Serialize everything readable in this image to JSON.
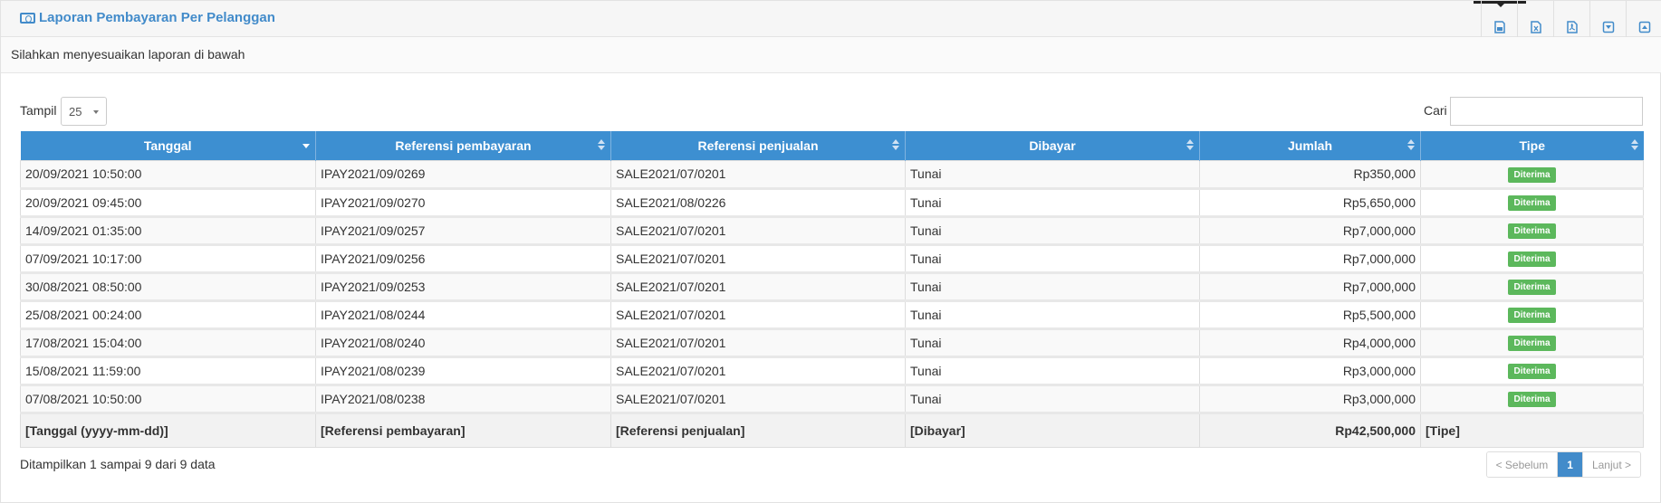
{
  "header": {
    "title": "Laporan Pembayaran Per Pelanggan",
    "toolbar": [
      {
        "icon": "save-image-icon"
      },
      {
        "icon": "excel-icon"
      },
      {
        "icon": "pdf-icon"
      },
      {
        "icon": "collapse-down-icon"
      },
      {
        "icon": "collapse-up-icon"
      }
    ]
  },
  "subheader": {
    "text": "Silahkan menyesuaikan laporan di bawah"
  },
  "controls": {
    "show_label": "Tampil",
    "page_length": "25",
    "search_label": "Cari",
    "search_value": ""
  },
  "table": {
    "columns": [
      "Tanggal",
      "Referensi pembayaran",
      "Referensi penjualan",
      "Dibayar",
      "Jumlah",
      "Tipe"
    ],
    "rows": [
      {
        "tanggal": "20/09/2021 10:50:00",
        "ref_bayar": "IPAY2021/09/0269",
        "ref_jual": "SALE2021/07/0201",
        "dibayar": "Tunai",
        "jumlah": "Rp350,000",
        "tipe": "Diterima"
      },
      {
        "tanggal": "20/09/2021 09:45:00",
        "ref_bayar": "IPAY2021/09/0270",
        "ref_jual": "SALE2021/08/0226",
        "dibayar": "Tunai",
        "jumlah": "Rp5,650,000",
        "tipe": "Diterima"
      },
      {
        "tanggal": "14/09/2021 01:35:00",
        "ref_bayar": "IPAY2021/09/0257",
        "ref_jual": "SALE2021/07/0201",
        "dibayar": "Tunai",
        "jumlah": "Rp7,000,000",
        "tipe": "Diterima"
      },
      {
        "tanggal": "07/09/2021 10:17:00",
        "ref_bayar": "IPAY2021/09/0256",
        "ref_jual": "SALE2021/07/0201",
        "dibayar": "Tunai",
        "jumlah": "Rp7,000,000",
        "tipe": "Diterima"
      },
      {
        "tanggal": "30/08/2021 08:50:00",
        "ref_bayar": "IPAY2021/09/0253",
        "ref_jual": "SALE2021/07/0201",
        "dibayar": "Tunai",
        "jumlah": "Rp7,000,000",
        "tipe": "Diterima"
      },
      {
        "tanggal": "25/08/2021 00:24:00",
        "ref_bayar": "IPAY2021/08/0244",
        "ref_jual": "SALE2021/07/0201",
        "dibayar": "Tunai",
        "jumlah": "Rp5,500,000",
        "tipe": "Diterima"
      },
      {
        "tanggal": "17/08/2021 15:04:00",
        "ref_bayar": "IPAY2021/08/0240",
        "ref_jual": "SALE2021/07/0201",
        "dibayar": "Tunai",
        "jumlah": "Rp4,000,000",
        "tipe": "Diterima"
      },
      {
        "tanggal": "15/08/2021 11:59:00",
        "ref_bayar": "IPAY2021/08/0239",
        "ref_jual": "SALE2021/07/0201",
        "dibayar": "Tunai",
        "jumlah": "Rp3,000,000",
        "tipe": "Diterima"
      },
      {
        "tanggal": "07/08/2021 10:50:00",
        "ref_bayar": "IPAY2021/08/0238",
        "ref_jual": "SALE2021/07/0201",
        "dibayar": "Tunai",
        "jumlah": "Rp3,000,000",
        "tipe": "Diterima"
      }
    ],
    "footer": {
      "tanggal": "[Tanggal (yyyy-mm-dd)]",
      "ref_bayar": "[Referensi pembayaran]",
      "ref_jual": "[Referensi penjualan]",
      "dibayar": "[Dibayar]",
      "jumlah": "Rp42,500,000",
      "tipe": "[Tipe]"
    }
  },
  "pagination": {
    "info": "Ditampilkan 1 sampai 9 dari 9 data",
    "prev": "< Sebelum",
    "page": "1",
    "next": "Lanjut >"
  },
  "colors": {
    "header_blue": "#3d8fd1",
    "title_blue": "#428bca",
    "badge_green": "#5cb85c"
  }
}
